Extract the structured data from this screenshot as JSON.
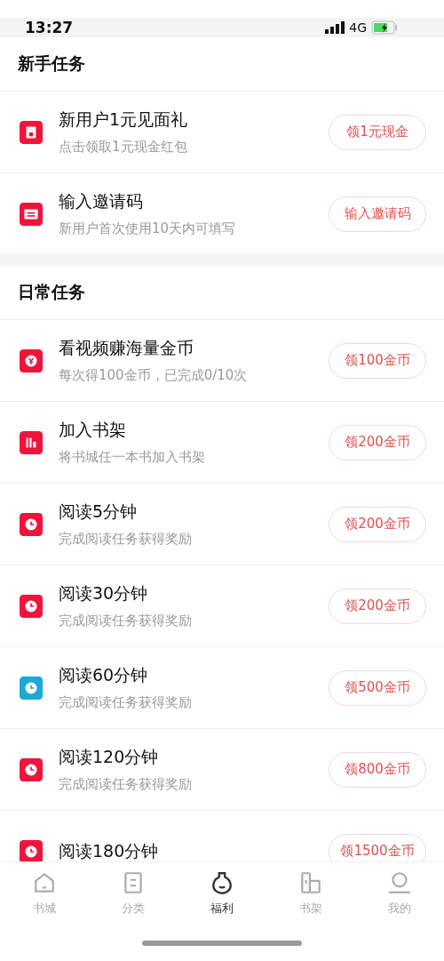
{
  "status_bar": {
    "time": "13:27",
    "network": "4G"
  },
  "sections": [
    {
      "title": "新手任务",
      "tasks": [
        {
          "kind": "gift",
          "color": "#f0143c",
          "title": "新用户1元见面礼",
          "subtitle": "点击领取1元现金红包",
          "button": "领1元现金"
        },
        {
          "kind": "ticket",
          "color": "#f0143c",
          "title": "输入邀请码",
          "subtitle": "新用户首次使用10天内可填写",
          "button": "输入邀请码"
        }
      ]
    },
    {
      "title": "日常任务",
      "tasks": [
        {
          "kind": "coin",
          "color": "#f0143c",
          "title": "看视频赚海量金币",
          "subtitle": "每次得100金币，已完成0/10次",
          "button": "领100金币"
        },
        {
          "kind": "shelf",
          "color": "#f0143c",
          "title": "加入书架",
          "subtitle": "将书城任一本书加入书架",
          "button": "领200金币"
        },
        {
          "kind": "clock",
          "color": "#f0143c",
          "title": "阅读5分钟",
          "subtitle": "完成阅读任务获得奖励",
          "button": "领200金币"
        },
        {
          "kind": "clock",
          "color": "#f0143c",
          "title": "阅读30分钟",
          "subtitle": "完成阅读任务获得奖励",
          "button": "领200金币"
        },
        {
          "kind": "clock",
          "color": "#1ba8d8",
          "title": "阅读60分钟",
          "subtitle": "完成阅读任务获得奖励",
          "button": "领500金币"
        },
        {
          "kind": "clock",
          "color": "#f0143c",
          "title": "阅读120分钟",
          "subtitle": "完成阅读任务获得奖励",
          "button": "领800金币"
        },
        {
          "kind": "clock",
          "color": "#f0143c",
          "title": "阅读180分钟",
          "button": "领1500金币"
        }
      ]
    }
  ],
  "tab_bar": [
    {
      "kind": "home",
      "label": "书城",
      "selected": false
    },
    {
      "kind": "list",
      "label": "分类",
      "selected": false
    },
    {
      "kind": "vase",
      "label": "福利",
      "selected": true
    },
    {
      "kind": "shelf",
      "label": "书架",
      "selected": false
    },
    {
      "kind": "person",
      "label": "我的",
      "selected": false
    }
  ]
}
